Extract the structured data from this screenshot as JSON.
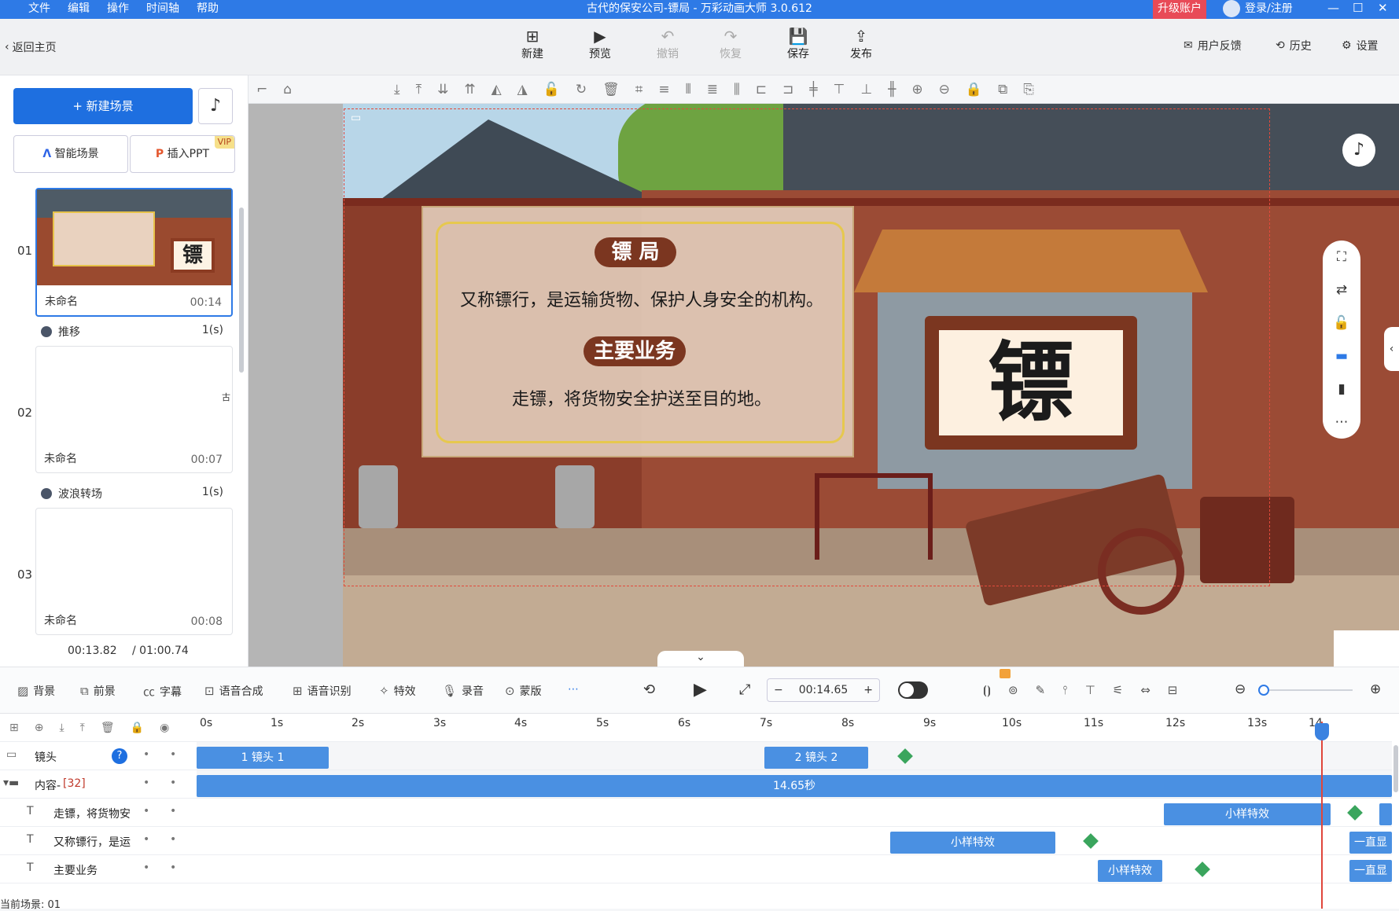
{
  "titlebar": {
    "menu": [
      "文件",
      "编辑",
      "操作",
      "时间轴",
      "帮助"
    ],
    "title": "古代的保安公司-镖局 - 万彩动画大师 3.0.612",
    "upgrade": "升级账户",
    "login": "登录/注册"
  },
  "toolbar": {
    "back": "返回主页",
    "new": "新建",
    "preview": "预览",
    "undo": "撤销",
    "redo": "恢复",
    "save": "保存",
    "publish": "发布",
    "feedback": "用户反馈",
    "history": "历史",
    "settings": "设置"
  },
  "left": {
    "new_scene": "+ 新建场景",
    "smart_scene": "智能场景",
    "insert_ppt": "插入PPT",
    "vip": "VIP",
    "scenes": [
      {
        "num": "01",
        "name": "未命名",
        "dur": "00:14"
      },
      {
        "num": "02",
        "name": "未命名",
        "dur": "00:07"
      },
      {
        "num": "03",
        "name": "未命名",
        "dur": "00:08"
      }
    ],
    "transitions": [
      {
        "name": "推移",
        "dur": "1(s)"
      },
      {
        "name": "波浪转场",
        "dur": "1(s)"
      }
    ],
    "thumb_text": "镖",
    "scene2_char": "古",
    "time_current": "00:13.82",
    "time_total": "/ 01:00.74"
  },
  "stage": {
    "title1": "镖 局",
    "text1": "又称镖行，是运输货物、保护人身安全的机构。",
    "title2": "主要业务",
    "text2": "走镖，将货物安全护送至目的地。",
    "sign": "镖"
  },
  "bottombar": {
    "bg": "背景",
    "fg": "前景",
    "subtitle": "字幕",
    "tts": "语音合成",
    "asr": "语音识别",
    "effects": "特效",
    "record": "录音",
    "mask": "蒙版",
    "time": "00:14.65"
  },
  "timeline": {
    "ruler": [
      "0s",
      "1s",
      "2s",
      "3s",
      "4s",
      "5s",
      "6s",
      "7s",
      "8s",
      "9s",
      "10s",
      "11s",
      "12s",
      "13s",
      "14"
    ],
    "rows": [
      {
        "label": "镜头",
        "clips": [
          "1 镜头 1",
          "2 镜头 2"
        ]
      },
      {
        "label": "内容-",
        "count": "[32]",
        "clip": "14.65秒"
      },
      {
        "label": "走镖，将货物安",
        "clip": "小样特效"
      },
      {
        "label": "又称镖行，是运",
        "clip": "小样特效",
        "tail": "一直显"
      },
      {
        "label": "主要业务",
        "clip": "小样特效",
        "tail": "一直显"
      }
    ],
    "current_scene": "当前场景: 01"
  }
}
